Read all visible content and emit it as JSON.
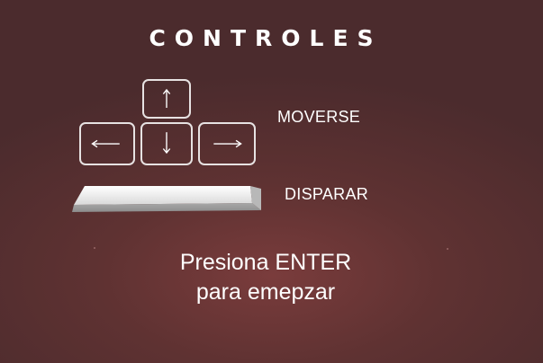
{
  "title": "CONTROLES",
  "controls": {
    "move_label": "MOVERSE",
    "shoot_label": "DISPARAR",
    "keys": [
      "arrow-up-key",
      "arrow-left-key",
      "arrow-down-key",
      "arrow-right-key",
      "spacebar-key"
    ]
  },
  "prompt": {
    "line1": "Presiona ENTER",
    "line2": "para emepzar"
  },
  "colors": {
    "background": "#5f3232",
    "text": "#ffffff",
    "key_outline": "#e7e2e2"
  }
}
